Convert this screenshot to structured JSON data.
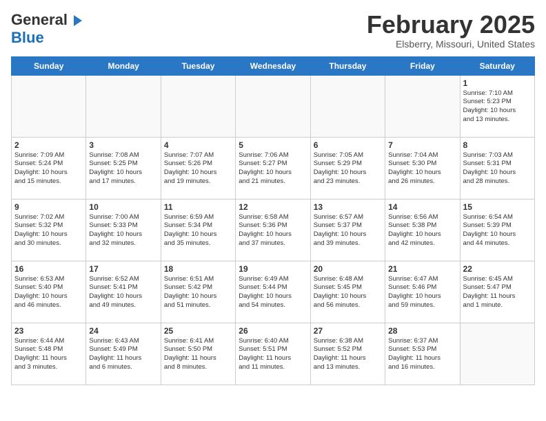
{
  "header": {
    "logo_general": "General",
    "logo_blue": "Blue",
    "month_title": "February 2025",
    "location": "Elsberry, Missouri, United States"
  },
  "calendar": {
    "days_of_week": [
      "Sunday",
      "Monday",
      "Tuesday",
      "Wednesday",
      "Thursday",
      "Friday",
      "Saturday"
    ],
    "weeks": [
      [
        {
          "day": "",
          "info": ""
        },
        {
          "day": "",
          "info": ""
        },
        {
          "day": "",
          "info": ""
        },
        {
          "day": "",
          "info": ""
        },
        {
          "day": "",
          "info": ""
        },
        {
          "day": "",
          "info": ""
        },
        {
          "day": "1",
          "info": "Sunrise: 7:10 AM\nSunset: 5:23 PM\nDaylight: 10 hours\nand 13 minutes."
        }
      ],
      [
        {
          "day": "2",
          "info": "Sunrise: 7:09 AM\nSunset: 5:24 PM\nDaylight: 10 hours\nand 15 minutes."
        },
        {
          "day": "3",
          "info": "Sunrise: 7:08 AM\nSunset: 5:25 PM\nDaylight: 10 hours\nand 17 minutes."
        },
        {
          "day": "4",
          "info": "Sunrise: 7:07 AM\nSunset: 5:26 PM\nDaylight: 10 hours\nand 19 minutes."
        },
        {
          "day": "5",
          "info": "Sunrise: 7:06 AM\nSunset: 5:27 PM\nDaylight: 10 hours\nand 21 minutes."
        },
        {
          "day": "6",
          "info": "Sunrise: 7:05 AM\nSunset: 5:29 PM\nDaylight: 10 hours\nand 23 minutes."
        },
        {
          "day": "7",
          "info": "Sunrise: 7:04 AM\nSunset: 5:30 PM\nDaylight: 10 hours\nand 26 minutes."
        },
        {
          "day": "8",
          "info": "Sunrise: 7:03 AM\nSunset: 5:31 PM\nDaylight: 10 hours\nand 28 minutes."
        }
      ],
      [
        {
          "day": "9",
          "info": "Sunrise: 7:02 AM\nSunset: 5:32 PM\nDaylight: 10 hours\nand 30 minutes."
        },
        {
          "day": "10",
          "info": "Sunrise: 7:00 AM\nSunset: 5:33 PM\nDaylight: 10 hours\nand 32 minutes."
        },
        {
          "day": "11",
          "info": "Sunrise: 6:59 AM\nSunset: 5:34 PM\nDaylight: 10 hours\nand 35 minutes."
        },
        {
          "day": "12",
          "info": "Sunrise: 6:58 AM\nSunset: 5:36 PM\nDaylight: 10 hours\nand 37 minutes."
        },
        {
          "day": "13",
          "info": "Sunrise: 6:57 AM\nSunset: 5:37 PM\nDaylight: 10 hours\nand 39 minutes."
        },
        {
          "day": "14",
          "info": "Sunrise: 6:56 AM\nSunset: 5:38 PM\nDaylight: 10 hours\nand 42 minutes."
        },
        {
          "day": "15",
          "info": "Sunrise: 6:54 AM\nSunset: 5:39 PM\nDaylight: 10 hours\nand 44 minutes."
        }
      ],
      [
        {
          "day": "16",
          "info": "Sunrise: 6:53 AM\nSunset: 5:40 PM\nDaylight: 10 hours\nand 46 minutes."
        },
        {
          "day": "17",
          "info": "Sunrise: 6:52 AM\nSunset: 5:41 PM\nDaylight: 10 hours\nand 49 minutes."
        },
        {
          "day": "18",
          "info": "Sunrise: 6:51 AM\nSunset: 5:42 PM\nDaylight: 10 hours\nand 51 minutes."
        },
        {
          "day": "19",
          "info": "Sunrise: 6:49 AM\nSunset: 5:44 PM\nDaylight: 10 hours\nand 54 minutes."
        },
        {
          "day": "20",
          "info": "Sunrise: 6:48 AM\nSunset: 5:45 PM\nDaylight: 10 hours\nand 56 minutes."
        },
        {
          "day": "21",
          "info": "Sunrise: 6:47 AM\nSunset: 5:46 PM\nDaylight: 10 hours\nand 59 minutes."
        },
        {
          "day": "22",
          "info": "Sunrise: 6:45 AM\nSunset: 5:47 PM\nDaylight: 11 hours\nand 1 minute."
        }
      ],
      [
        {
          "day": "23",
          "info": "Sunrise: 6:44 AM\nSunset: 5:48 PM\nDaylight: 11 hours\nand 3 minutes."
        },
        {
          "day": "24",
          "info": "Sunrise: 6:43 AM\nSunset: 5:49 PM\nDaylight: 11 hours\nand 6 minutes."
        },
        {
          "day": "25",
          "info": "Sunrise: 6:41 AM\nSunset: 5:50 PM\nDaylight: 11 hours\nand 8 minutes."
        },
        {
          "day": "26",
          "info": "Sunrise: 6:40 AM\nSunset: 5:51 PM\nDaylight: 11 hours\nand 11 minutes."
        },
        {
          "day": "27",
          "info": "Sunrise: 6:38 AM\nSunset: 5:52 PM\nDaylight: 11 hours\nand 13 minutes."
        },
        {
          "day": "28",
          "info": "Sunrise: 6:37 AM\nSunset: 5:53 PM\nDaylight: 11 hours\nand 16 minutes."
        },
        {
          "day": "",
          "info": ""
        }
      ]
    ]
  }
}
